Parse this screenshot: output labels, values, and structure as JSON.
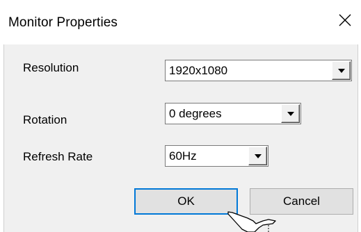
{
  "window": {
    "title": "Monitor Properties",
    "close_icon": "close-icon"
  },
  "form": {
    "resolution": {
      "label": "Resolution",
      "value": "1920x1080"
    },
    "rotation": {
      "label": "Rotation",
      "value": "0 degrees"
    },
    "refresh_rate": {
      "label": "Refresh Rate",
      "value": "60Hz"
    }
  },
  "buttons": {
    "ok_label": "OK",
    "cancel_label": "Cancel"
  },
  "icons": {
    "dropdown": "chevron-down-icon",
    "pointer": "mouse-cursor-icon"
  },
  "colors": {
    "accent": "#0078d7",
    "panel_bg": "#f0f0f0",
    "button_bg": "#e1e1e1"
  }
}
